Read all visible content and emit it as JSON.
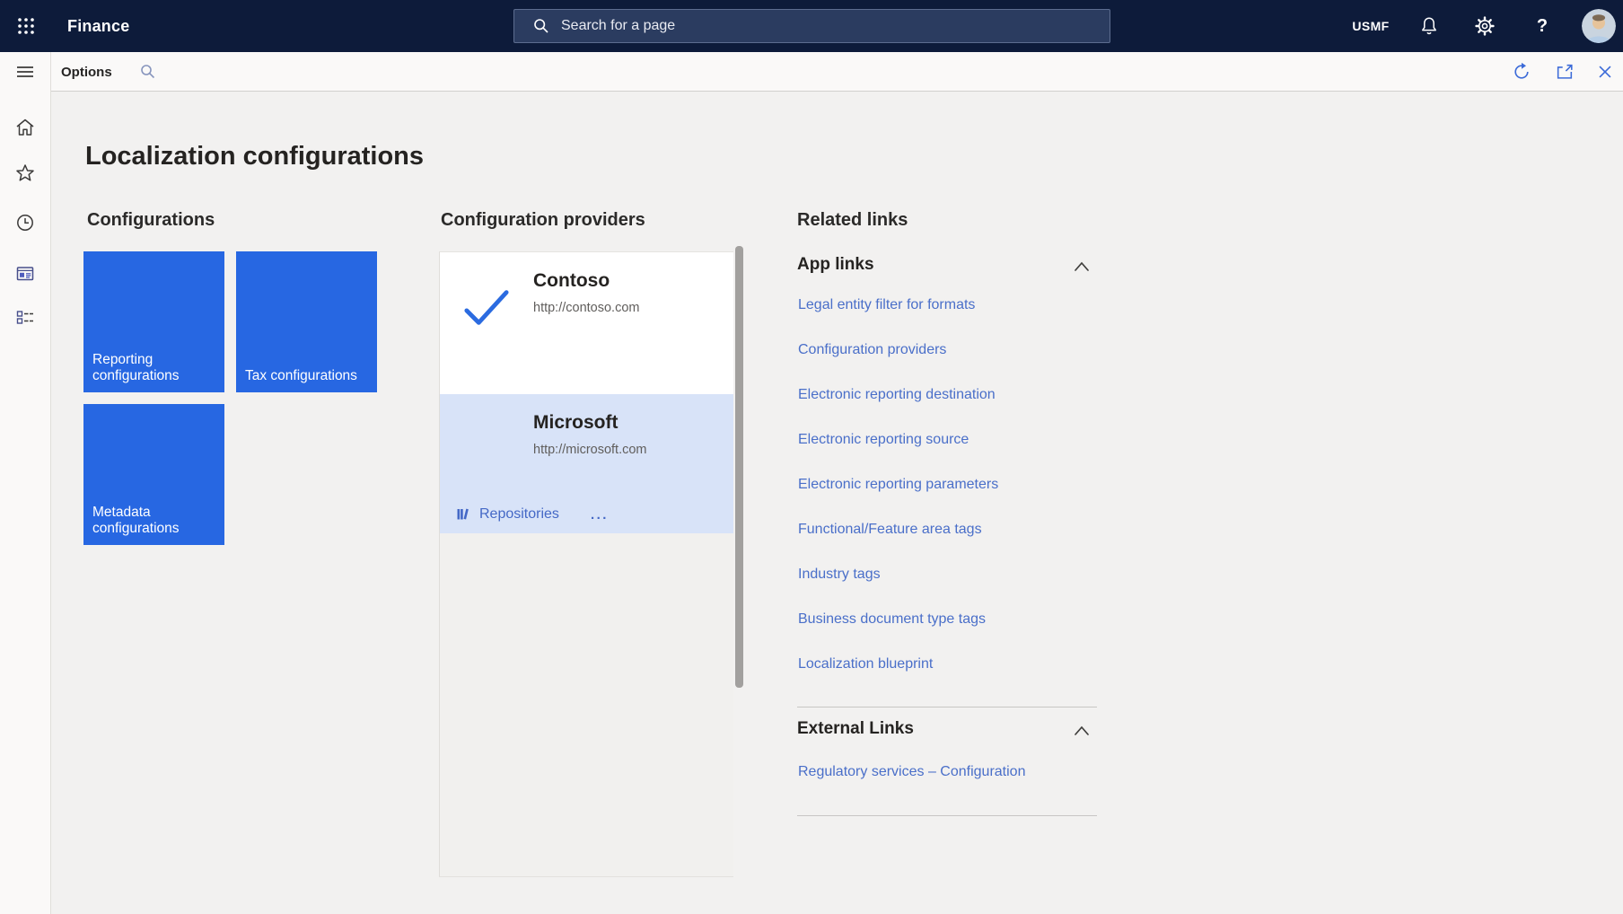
{
  "topbar": {
    "app_name": "Finance",
    "search_placeholder": "Search for a page",
    "company": "USMF",
    "help_label": "?"
  },
  "toolbar": {
    "options_label": "Options"
  },
  "page": {
    "title": "Localization configurations"
  },
  "configurations": {
    "header": "Configurations",
    "tiles": [
      {
        "label": "Reporting configurations"
      },
      {
        "label": "Tax configurations"
      },
      {
        "label": "Metadata configurations"
      }
    ]
  },
  "providers": {
    "header": "Configuration providers",
    "items": [
      {
        "name": "Contoso",
        "url": "http://contoso.com",
        "checked": true,
        "selected": false
      },
      {
        "name": "Microsoft",
        "url": "http://microsoft.com",
        "checked": false,
        "selected": true,
        "repositories_label": "Repositories",
        "more_label": "..."
      }
    ]
  },
  "related_links": {
    "header": "Related links",
    "groups": [
      {
        "title": "App links",
        "collapsed": false,
        "links": [
          "Legal entity filter for formats",
          "Configuration providers",
          "Electronic reporting destination",
          "Electronic reporting source",
          "Electronic reporting parameters",
          "Functional/Feature area tags",
          "Industry tags",
          "Business document type tags",
          "Localization blueprint"
        ]
      },
      {
        "title": "External Links",
        "collapsed": false,
        "links": [
          "Regulatory services – Configuration"
        ]
      }
    ]
  },
  "icons": {
    "topbar": [
      "app-launcher-waffle",
      "search",
      "bell",
      "gear",
      "help",
      "avatar"
    ],
    "toolbar": [
      "hamburger-menu",
      "search",
      "refresh",
      "open-in-new-window",
      "close"
    ],
    "sidebar": [
      "home",
      "star-favorites",
      "clock-recent",
      "workspace-form",
      "task-list"
    ],
    "provider": [
      "checkmark",
      "repository-books",
      "ellipsis-more"
    ],
    "related": [
      "chevron-up"
    ]
  },
  "colors": {
    "topbar_bg": "#0d1b3a",
    "tile_blue": "#2767e2",
    "selected_card_blue": "#d8e3f8",
    "link_blue": "#4a6fc9",
    "content_bg": "#f2f1f0"
  }
}
